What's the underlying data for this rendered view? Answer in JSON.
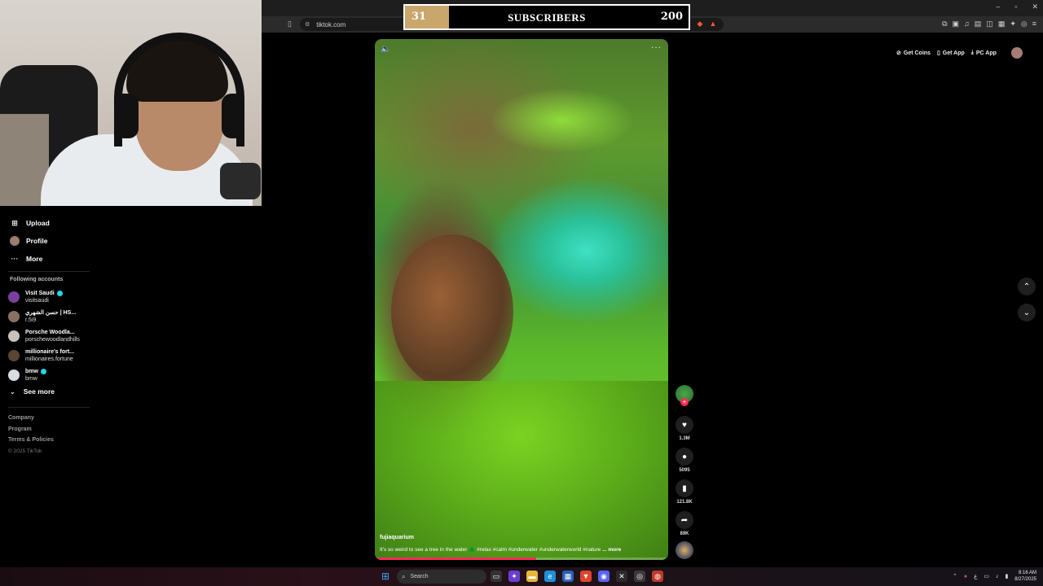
{
  "browser": {
    "url": "tiktok.com",
    "window_controls": [
      "–",
      "▫",
      "✕"
    ]
  },
  "subscriber_goal": {
    "current": "31",
    "title": "SUBSCRIBERS",
    "goal": "200",
    "progress_fraction": 0.155,
    "fill_color": "#c9a66b"
  },
  "sidebar": {
    "menu": [
      {
        "label": "Upload",
        "icon": "plus-square-icon"
      },
      {
        "label": "Profile",
        "icon": "avatar-icon"
      },
      {
        "label": "More",
        "icon": "more-dots-icon"
      }
    ],
    "following_heading": "Following accounts",
    "accounts": [
      {
        "name": "Visit Saudi",
        "handle": "visitsaudi",
        "verified": true,
        "color": "#7b3fa0"
      },
      {
        "name": "حسن الشهري | HS...",
        "handle": "r.5i9",
        "verified": false,
        "color": "#8a7060"
      },
      {
        "name": "Porsche Woodla...",
        "handle": "porschewoodlandhills",
        "verified": false,
        "color": "#c9c2b8"
      },
      {
        "name": "millionaire's fort...",
        "handle": "millionaires.fortune",
        "verified": false,
        "color": "#5a4630"
      },
      {
        "name": "bmw",
        "handle": "bmw",
        "verified": true,
        "color": "#d8dde3"
      }
    ],
    "see_more": "See more",
    "footer": [
      "Company",
      "Program",
      "Terms & Policies"
    ],
    "copyright": "© 2025 TikTok"
  },
  "top_actions": {
    "get_coins": "Get Coins",
    "get_app": "Get App",
    "pc_app": "PC App"
  },
  "video": {
    "author": "fujiaquarium",
    "caption": "It's so weird to see a tree in the water 🌲 #relax #calm #underwater #underwaterworld #nature",
    "more_label": "... more",
    "progress_fraction": 0.55,
    "likes": "1.3M",
    "comments": "5095",
    "saves": "121.8K",
    "shares": "89K"
  },
  "taskbar": {
    "search_placeholder": "Search",
    "time": "8:16 AM",
    "date": "8/27/2025",
    "lang": "ع"
  }
}
